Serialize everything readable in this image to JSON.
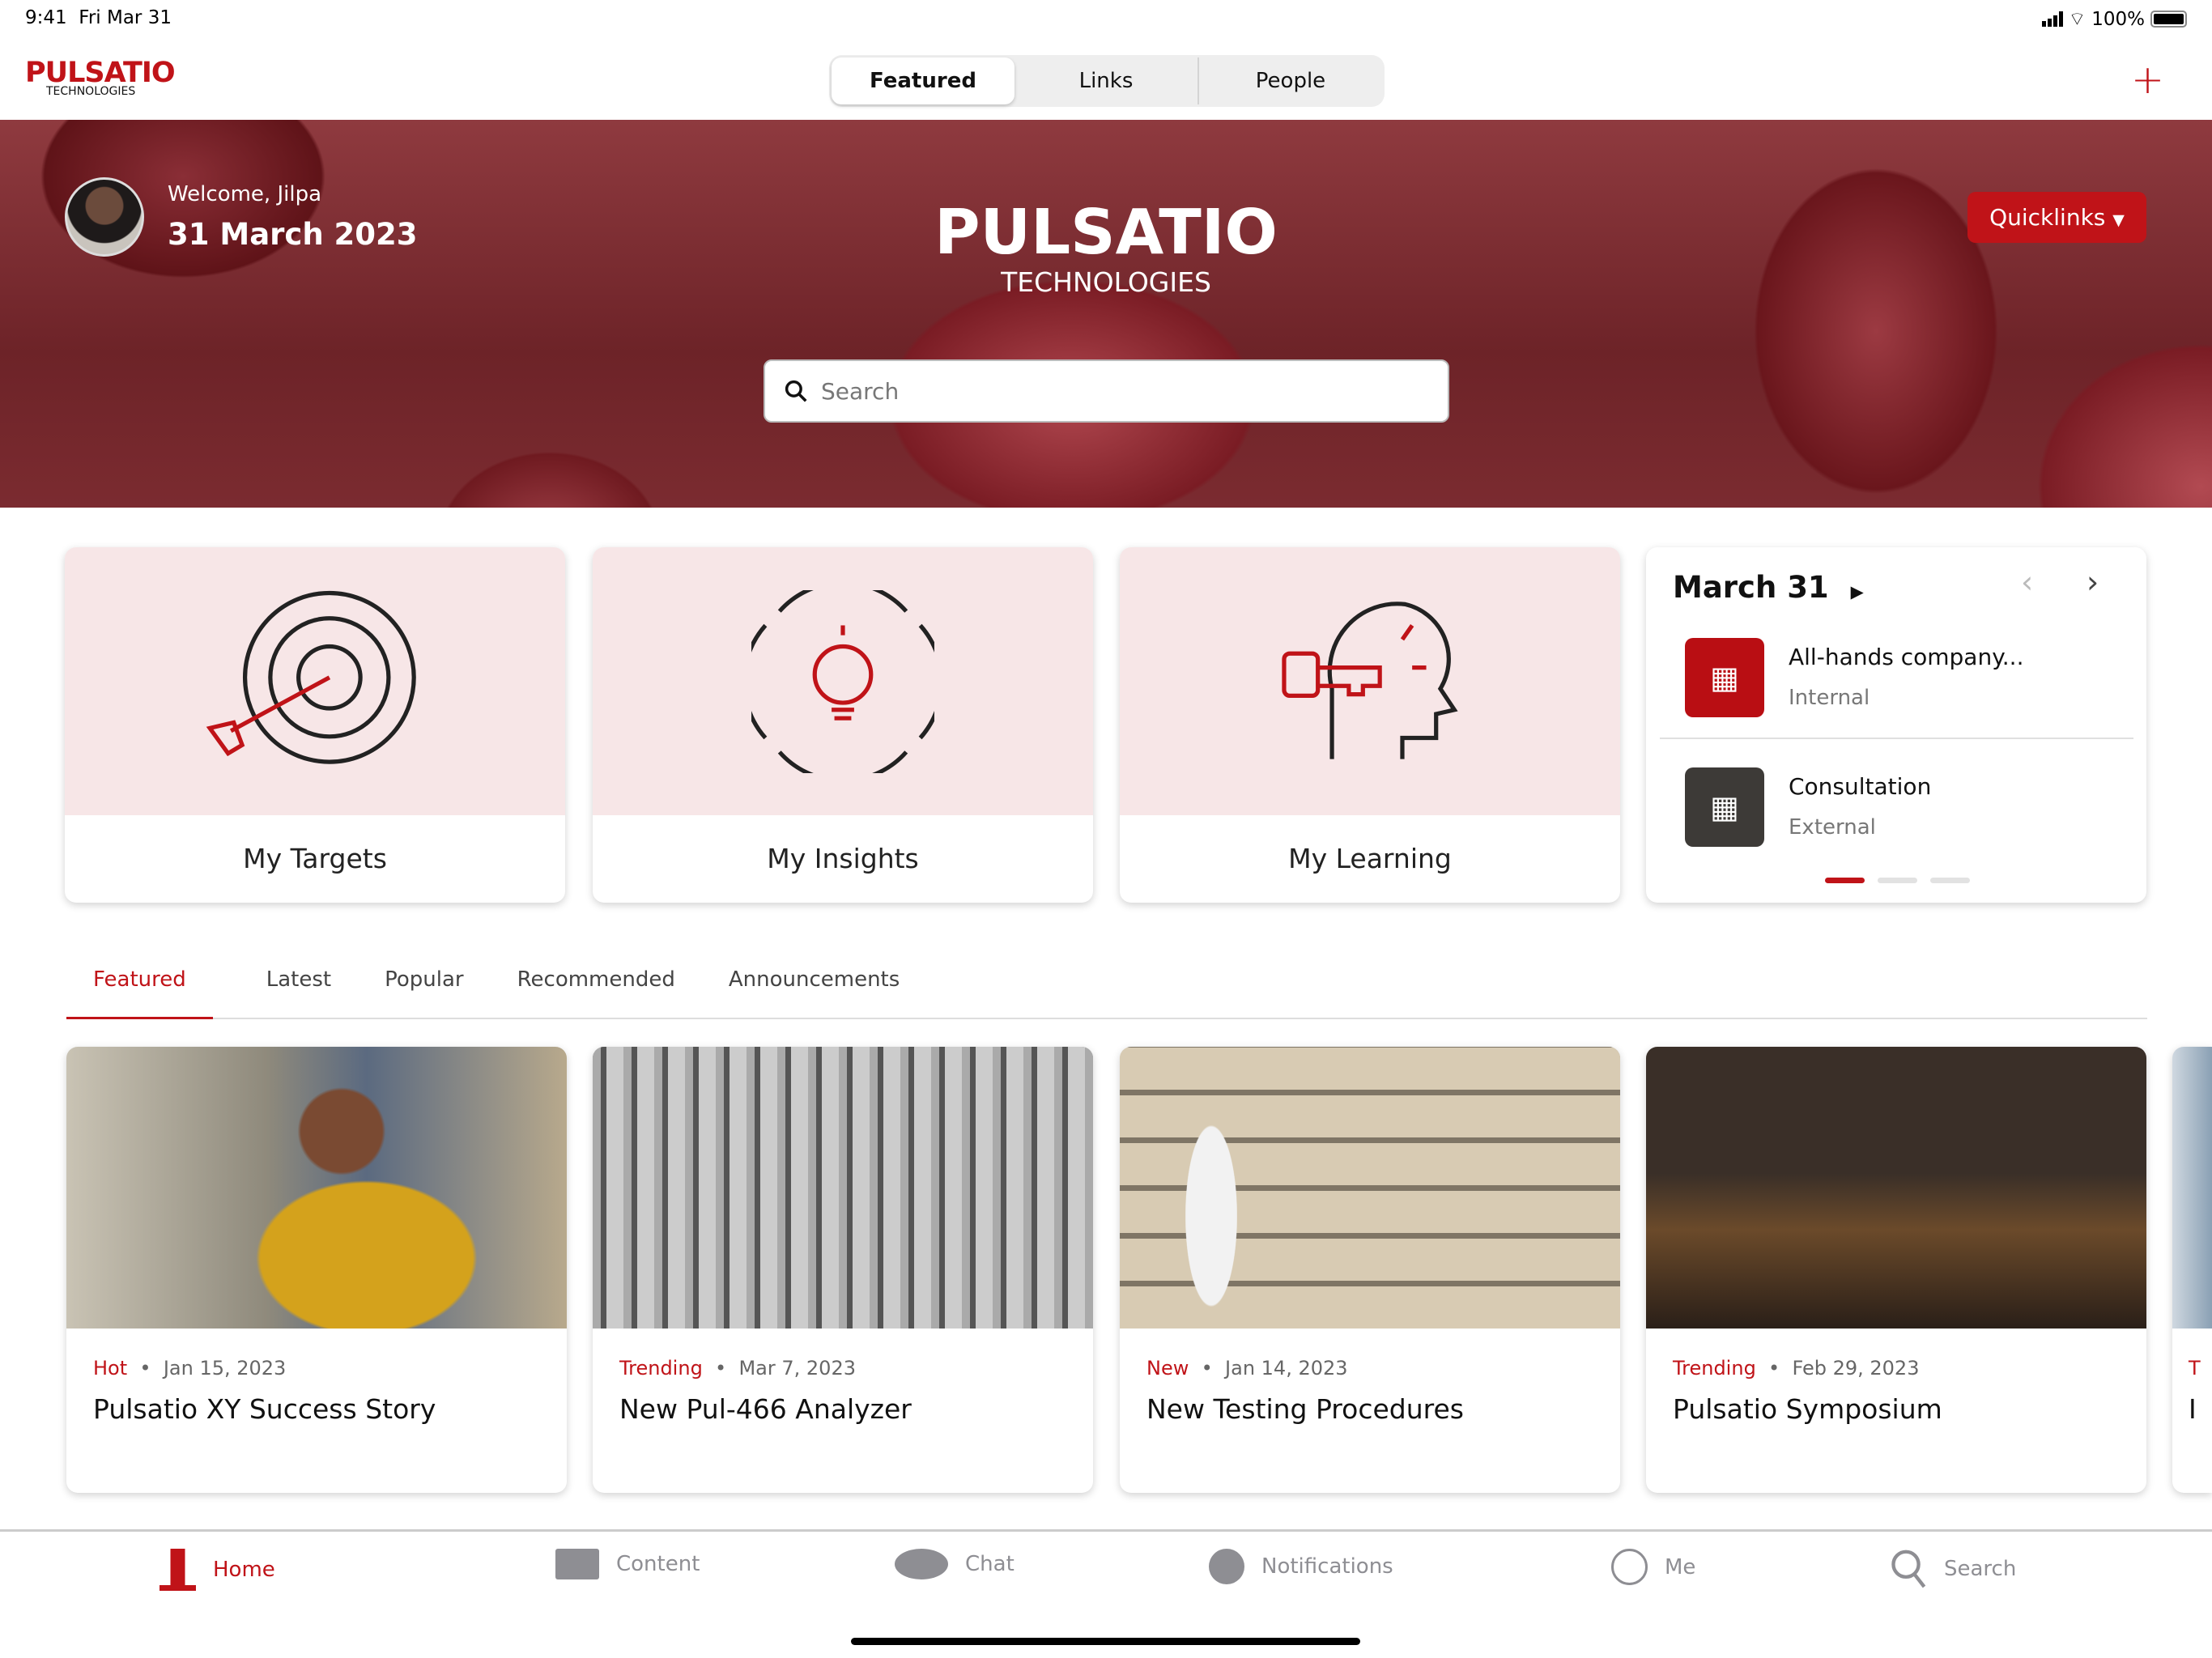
{
  "status_bar": {
    "time": "9:41",
    "date": "Fri Mar 31",
    "battery": "100%"
  },
  "header": {
    "logo": "PULSATIO",
    "logo_sub": "TECHNOLOGIES",
    "segments": [
      "Featured",
      "Links",
      "People"
    ],
    "active_segment": 0,
    "add_icon": "plus-icon"
  },
  "hero": {
    "welcome": "Welcome, Jilpa",
    "date": "31 March 2023",
    "brand": "PULSATIO",
    "brand_sub": "TECHNOLOGIES",
    "search_placeholder": "Search",
    "quicklinks": "Quicklinks"
  },
  "tiles": [
    {
      "label": "My Targets",
      "icon": "target-icon"
    },
    {
      "label": "My Insights",
      "icon": "lightbulb-icon"
    },
    {
      "label": "My Learning",
      "icon": "head-key-icon"
    }
  ],
  "calendar": {
    "title": "March 31",
    "events": [
      {
        "title": "All-hands company...",
        "type": "Internal",
        "color": "#b90e13"
      },
      {
        "title": "Consultation",
        "type": "External",
        "color": "#3d3a37"
      }
    ],
    "page": 1,
    "pages": 3
  },
  "content_tabs": [
    "Featured",
    "Latest",
    "Popular",
    "Recommended",
    "Announcements"
  ],
  "active_tab": 0,
  "news": [
    {
      "tag": "Hot",
      "date": "Jan 15, 2023",
      "title": "Pulsatio XY Success Story"
    },
    {
      "tag": "Trending",
      "date": "Mar 7, 2023",
      "title": "New Pul-466 Analyzer"
    },
    {
      "tag": "New",
      "date": "Jan 14, 2023",
      "title": "New Testing Procedures"
    },
    {
      "tag": "Trending",
      "date": "Feb 29, 2023",
      "title": "Pulsatio Symposium"
    },
    {
      "tag": "T",
      "date": "",
      "title": "I"
    }
  ],
  "bottom_nav": [
    {
      "label": "Home",
      "icon": "home-building-icon",
      "active": true
    },
    {
      "label": "Content",
      "icon": "content-icon"
    },
    {
      "label": "Chat",
      "icon": "chat-icon"
    },
    {
      "label": "Notifications",
      "icon": "clock-icon"
    },
    {
      "label": "Me",
      "icon": "person-icon"
    },
    {
      "label": "Search",
      "icon": "search-icon"
    }
  ],
  "colors": {
    "accent": "#c01318"
  }
}
